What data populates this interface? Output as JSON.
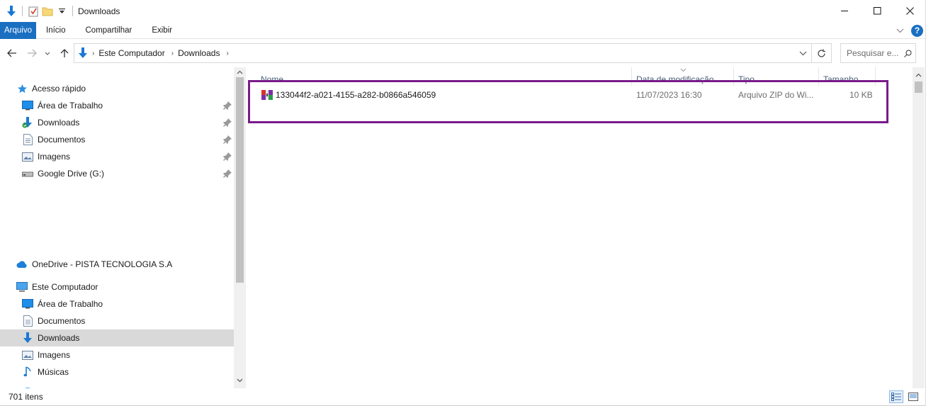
{
  "window": {
    "title": "Downloads"
  },
  "ribbon": {
    "tabs": [
      "Arquivo",
      "Início",
      "Compartilhar",
      "Exibir"
    ]
  },
  "address": {
    "crumbs": [
      "Este Computador",
      "Downloads"
    ],
    "search_placeholder": "Pesquisar e..."
  },
  "nav": {
    "quick_access": "Acesso rápido",
    "quick_items": [
      "Área de Trabalho",
      "Downloads",
      "Documentos",
      "Imagens",
      "Google Drive (G:)"
    ],
    "onedrive": "OneDrive - PISTA TECNOLOGIA S.A",
    "this_pc": "Este Computador",
    "pc_items": [
      "Área de Trabalho",
      "Documentos",
      "Downloads",
      "Imagens",
      "Músicas"
    ],
    "selected": "Downloads"
  },
  "columns": {
    "name": "Nome",
    "modified": "Data de modificação",
    "type": "Tipo",
    "size": "Tamanho"
  },
  "files": [
    {
      "name": "133044f2-a021-4155-a282-b0866a546059",
      "modified": "11/07/2023 16:30",
      "type": "Arquivo ZIP do Wi...",
      "size": "10 KB"
    }
  ],
  "status": {
    "item_count": "701 itens"
  },
  "colors": {
    "accent": "#1a6fc1",
    "highlight_box": "#7a1b8c",
    "selection": "#d9d9d9"
  }
}
